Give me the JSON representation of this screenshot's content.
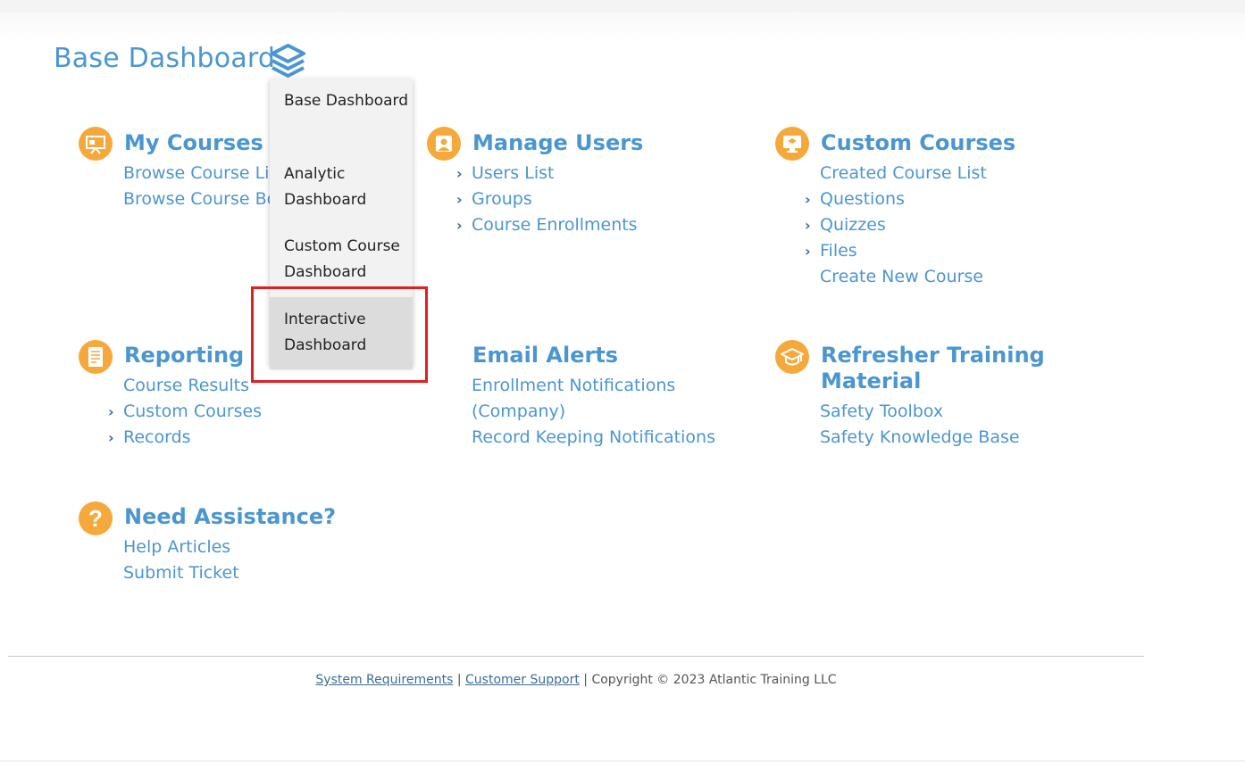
{
  "page": {
    "title": "Base Dashboard"
  },
  "dashboard_menu": {
    "items": [
      {
        "label": "Base Dashboard"
      },
      {
        "label": "Analytic Dashboard"
      },
      {
        "label": "Custom Course Dashboard"
      },
      {
        "label": "Interactive Dashboard"
      }
    ],
    "highlighted": "Interactive Dashboard"
  },
  "sections": {
    "my_courses": {
      "title": "My Courses",
      "links": [
        "Browse Course Library",
        "Browse Course Bookshelf"
      ]
    },
    "manage_users": {
      "title": "Manage Users",
      "links": [
        "Users List",
        "Groups",
        "Course Enrollments"
      ]
    },
    "custom_courses": {
      "title": "Custom Courses",
      "links": [
        "Created Course List",
        "Questions",
        "Quizzes",
        "Files",
        "Create New Course"
      ]
    },
    "reporting": {
      "title": "Reporting",
      "links": [
        "Course Results",
        "Custom Courses",
        "Records"
      ]
    },
    "email_alerts": {
      "title": "Email Alerts",
      "links": [
        "Enrollment Notifications",
        "(Company)",
        "Record Keeping Notifications"
      ]
    },
    "refresher": {
      "title_line1": "Refresher Training",
      "title_line2": "Material",
      "links": [
        "Safety Toolbox",
        "Safety Knowledge Base"
      ]
    },
    "assistance": {
      "title": "Need Assistance?",
      "links": [
        "Help Articles",
        "Submit Ticket"
      ]
    }
  },
  "footer": {
    "system_requirements": "System Requirements",
    "separator": " | ",
    "customer_support": "Customer Support",
    "copyright": " | Copyright © 2023 Atlantic Training LLC"
  },
  "colors": {
    "accent": "#4b96d0",
    "icon_bg": "#f6a93b",
    "highlight": "#e02020"
  },
  "icons": {
    "title": "layers-icon",
    "my_courses": "presentation-icon",
    "manage_users": "user-icon",
    "custom_courses": "monitor-icon",
    "reporting": "report-icon",
    "refresher": "graduation-cap-icon",
    "assistance": "question-icon"
  }
}
